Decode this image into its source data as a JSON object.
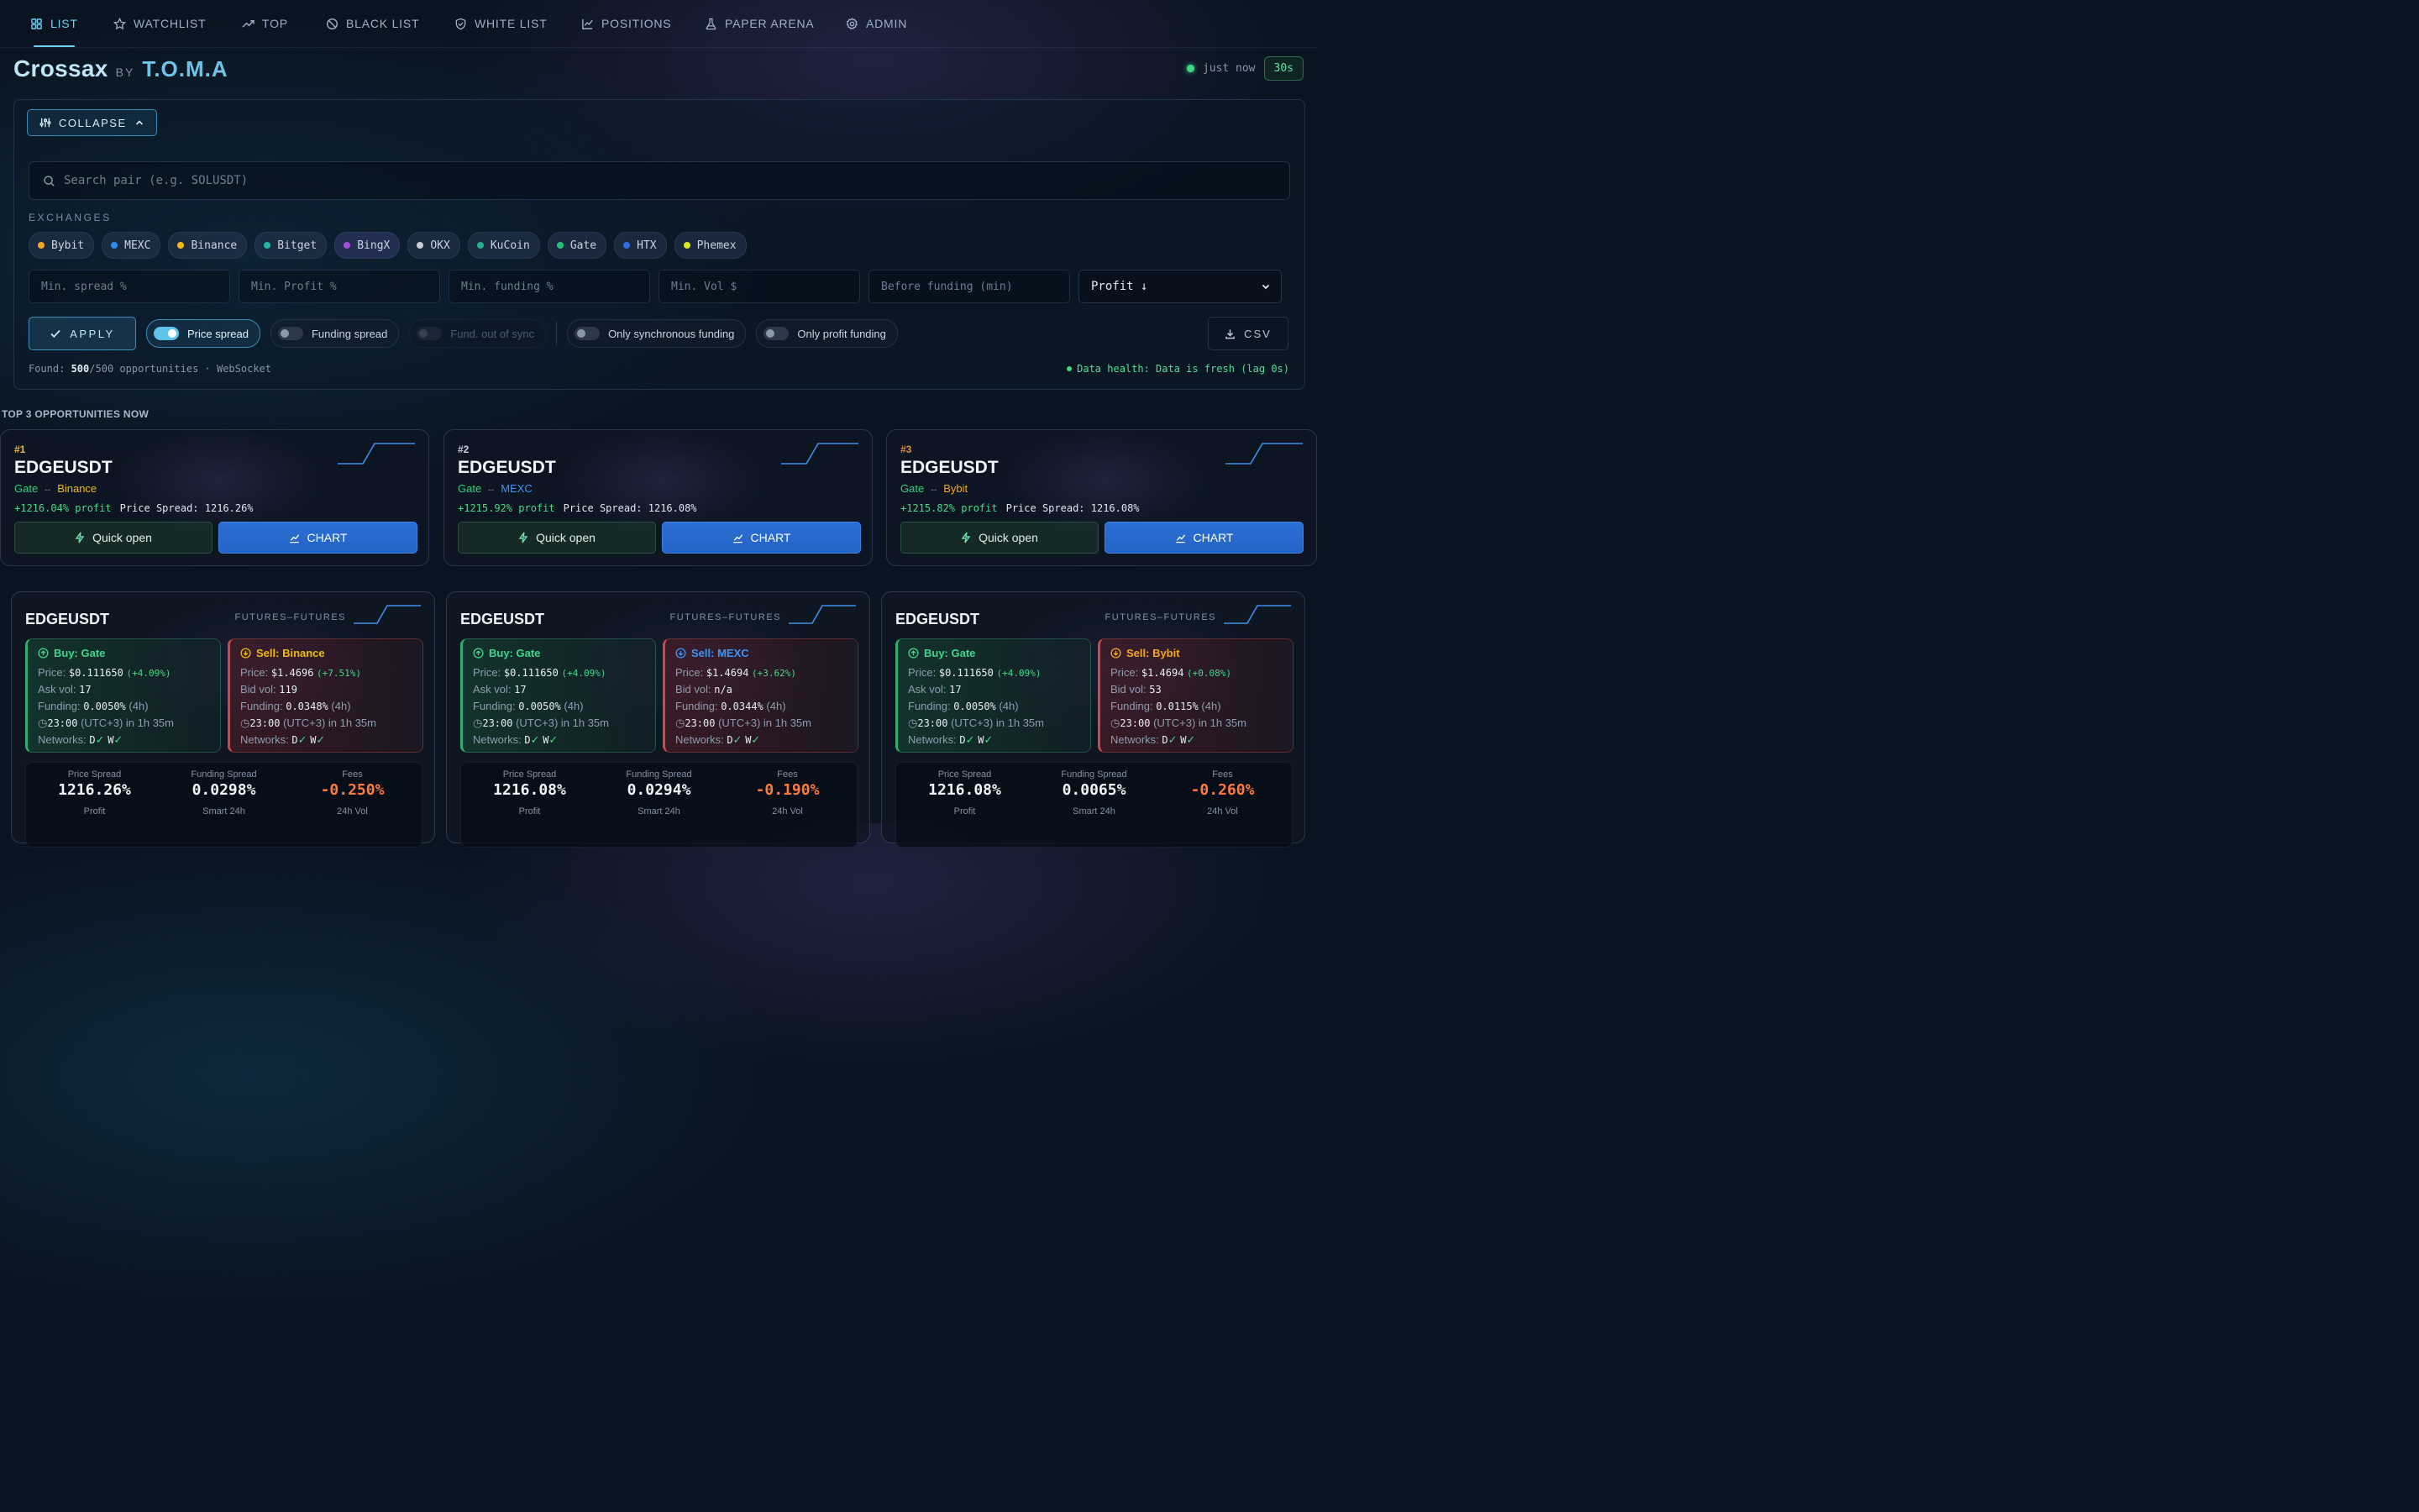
{
  "nav": [
    {
      "label": "LIST",
      "icon": "grid-icon",
      "active": true
    },
    {
      "label": "WATCHLIST",
      "icon": "star-icon"
    },
    {
      "label": "TOP",
      "icon": "trending-up-icon"
    },
    {
      "label": "BLACK LIST",
      "icon": "ban-icon"
    },
    {
      "label": "WHITE LIST",
      "icon": "shield-check-icon"
    },
    {
      "label": "POSITIONS",
      "icon": "line-chart-icon"
    },
    {
      "label": "PAPER ARENA",
      "icon": "flask-icon"
    },
    {
      "label": "ADMIN",
      "icon": "gear-icon"
    }
  ],
  "brand": {
    "name": "Crossax",
    "by": "BY",
    "author": "T.O.M.A"
  },
  "status": {
    "updated": "just now",
    "interval": "30s"
  },
  "filters": {
    "collapse_label": "COLLAPSE",
    "search_placeholder": "Search pair (e.g. SOLUSDT)",
    "exchanges_label": "EXCHANGES",
    "exchanges": [
      {
        "name": "Bybit",
        "color": "#f5a623"
      },
      {
        "name": "MEXC",
        "color": "#2d8cf0"
      },
      {
        "name": "Binance",
        "color": "#f0b90b"
      },
      {
        "name": "Bitget",
        "color": "#1fb8a6"
      },
      {
        "name": "BingX",
        "color": "#a24ddb"
      },
      {
        "name": "OKX",
        "color": "#c8ccd2"
      },
      {
        "name": "KuCoin",
        "color": "#23af91"
      },
      {
        "name": "Gate",
        "color": "#20c27a"
      },
      {
        "name": "HTX",
        "color": "#2f6de0"
      },
      {
        "name": "Phemex",
        "color": "#d8e81c"
      }
    ],
    "inputs": [
      {
        "placeholder": "Min. spread %"
      },
      {
        "placeholder": "Min. Profit %"
      },
      {
        "placeholder": "Min. funding %"
      },
      {
        "placeholder": "Min. Vol $"
      },
      {
        "placeholder": "Before funding (min)"
      }
    ],
    "sort": "Profit ↓",
    "apply_label": "APPLY",
    "toggles": [
      {
        "label": "Price spread",
        "state": "on"
      },
      {
        "label": "Funding spread",
        "state": "off"
      },
      {
        "label": "Fund. out of sync",
        "state": "disabled"
      },
      {
        "label": "Only synchronous funding",
        "state": "off"
      },
      {
        "label": "Only profit funding",
        "state": "off"
      }
    ],
    "csv_label": "CSV",
    "found_prefix": "Found: ",
    "found_count": "500",
    "found_suffix": "/500 opportunities · WebSocket",
    "health": "Data health: Data is fresh (lag 0s)"
  },
  "top_title": "TOP 3 OPPORTUNITIES NOW",
  "top_cards": [
    {
      "rank": "#1",
      "rank_color": "#f5b841",
      "symbol": "EDGEUSDT",
      "buy": "Gate",
      "buy_color": "#2fd07f",
      "sell": "Binance",
      "sell_color": "#f0b90b",
      "profit": "+1216.04% profit",
      "spread": "Price Spread: 1216.26%",
      "quick": "Quick open",
      "chart": "CHART"
    },
    {
      "rank": "#2",
      "rank_color": "#c9d1db",
      "symbol": "EDGEUSDT",
      "buy": "Gate",
      "buy_color": "#2fd07f",
      "sell": "MEXC",
      "sell_color": "#3d95f5",
      "profit": "+1215.92% profit",
      "spread": "Price Spread: 1216.08%",
      "quick": "Quick open",
      "chart": "CHART"
    },
    {
      "rank": "#3",
      "rank_color": "#e58a3a",
      "symbol": "EDGEUSDT",
      "buy": "Gate",
      "buy_color": "#2fd07f",
      "sell": "Bybit",
      "sell_color": "#f5a623",
      "profit": "+1215.82% profit",
      "spread": "Price Spread: 1216.08%",
      "quick": "Quick open",
      "chart": "CHART"
    }
  ],
  "details": [
    {
      "symbol": "EDGEUSDT",
      "type": "FUTURES–FUTURES",
      "buy": {
        "title": "Buy: Gate",
        "price": "$0.111650",
        "chg": "(+4.09%)",
        "vol_label": "Ask vol:",
        "vol": "17",
        "funding": "0.0050%",
        "period": "(4h)",
        "time": "23:00",
        "tz": "(UTC+3) in 1h 35m",
        "networks": "Networks:"
      },
      "sell": {
        "title": "Sell: Binance",
        "color": "#f0b90b",
        "price": "$1.4696",
        "chg": "(+7.51%)",
        "vol_label": "Bid vol:",
        "vol": "119",
        "funding": "0.0348%",
        "period": "(4h)",
        "time": "23:00",
        "tz": "(UTC+3) in 1h 35m",
        "networks": "Networks:"
      },
      "stats": {
        "price_spread_label": "Price Spread",
        "price_spread": "1216.26%",
        "funding_spread_label": "Funding Spread",
        "funding_spread": "0.0298%",
        "fees_label": "Fees",
        "fees": "-0.250%",
        "profit_label": "Profit",
        "smart_label": "Smart 24h",
        "vol_label": "24h Vol"
      }
    },
    {
      "symbol": "EDGEUSDT",
      "type": "FUTURES–FUTURES",
      "buy": {
        "title": "Buy: Gate",
        "price": "$0.111650",
        "chg": "(+4.09%)",
        "vol_label": "Ask vol:",
        "vol": "17",
        "funding": "0.0050%",
        "period": "(4h)",
        "time": "23:00",
        "tz": "(UTC+3) in 1h 35m",
        "networks": "Networks:"
      },
      "sell": {
        "title": "Sell: MEXC",
        "color": "#3d95f5",
        "price": "$1.4694",
        "chg": "(+3.62%)",
        "vol_label": "Bid vol:",
        "vol": "n/a",
        "funding": "0.0344%",
        "period": "(4h)",
        "time": "23:00",
        "tz": "(UTC+3) in 1h 35m",
        "networks": "Networks:"
      },
      "stats": {
        "price_spread_label": "Price Spread",
        "price_spread": "1216.08%",
        "funding_spread_label": "Funding Spread",
        "funding_spread": "0.0294%",
        "fees_label": "Fees",
        "fees": "-0.190%",
        "profit_label": "Profit",
        "smart_label": "Smart 24h",
        "vol_label": "24h Vol"
      }
    },
    {
      "symbol": "EDGEUSDT",
      "type": "FUTURES–FUTURES",
      "buy": {
        "title": "Buy: Gate",
        "price": "$0.111650",
        "chg": "(+4.09%)",
        "vol_label": "Ask vol:",
        "vol": "17",
        "funding": "0.0050%",
        "period": "(4h)",
        "time": "23:00",
        "tz": "(UTC+3) in 1h 35m",
        "networks": "Networks:"
      },
      "sell": {
        "title": "Sell: Bybit",
        "color": "#f5a623",
        "price": "$1.4694",
        "chg": "(+0.08%)",
        "vol_label": "Bid vol:",
        "vol": "53",
        "funding": "0.0115%",
        "period": "(4h)",
        "time": "23:00",
        "tz": "(UTC+3) in 1h 35m",
        "networks": "Networks:"
      },
      "stats": {
        "price_spread_label": "Price Spread",
        "price_spread": "1216.08%",
        "funding_spread_label": "Funding Spread",
        "funding_spread": "0.0065%",
        "fees_label": "Fees",
        "fees": "-0.260%",
        "profit_label": "Profit",
        "smart_label": "Smart 24h",
        "vol_label": "24h Vol"
      }
    }
  ]
}
